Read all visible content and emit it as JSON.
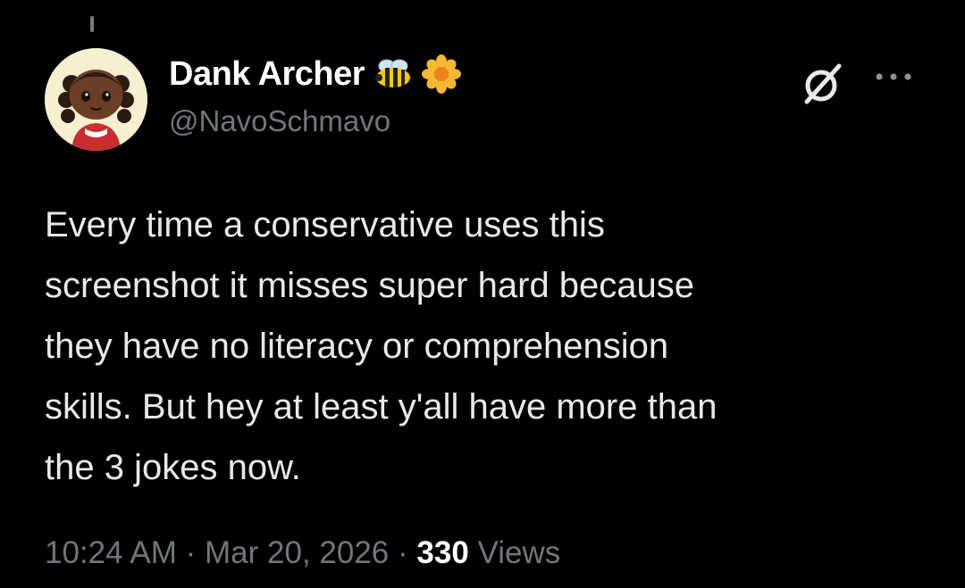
{
  "tweet": {
    "author": {
      "display_name": "Dank Archer",
      "handle": "@NavoSchmavo",
      "avatar_icon": "animal-crossing-villager-avatar",
      "name_emojis": [
        "bee-emoji",
        "blossom-emoji"
      ]
    },
    "text_lines": [
      "Every time a conservative uses this",
      "screenshot it misses super hard because",
      "they have no literacy or comprehension",
      "skills. But hey at least y'all have more than",
      "the 3 jokes now."
    ],
    "timestamp": {
      "time": "10:24 AM",
      "separator": "·",
      "date": "Mar 20, 2026"
    },
    "views": {
      "count": "330",
      "label": "Views"
    },
    "actions": {
      "grok_icon": "grok-icon",
      "more_icon": "more-options-icon"
    }
  },
  "colors": {
    "background": "#000000",
    "primary_text": "#e7e9ea",
    "secondary_text": "#71767b"
  }
}
